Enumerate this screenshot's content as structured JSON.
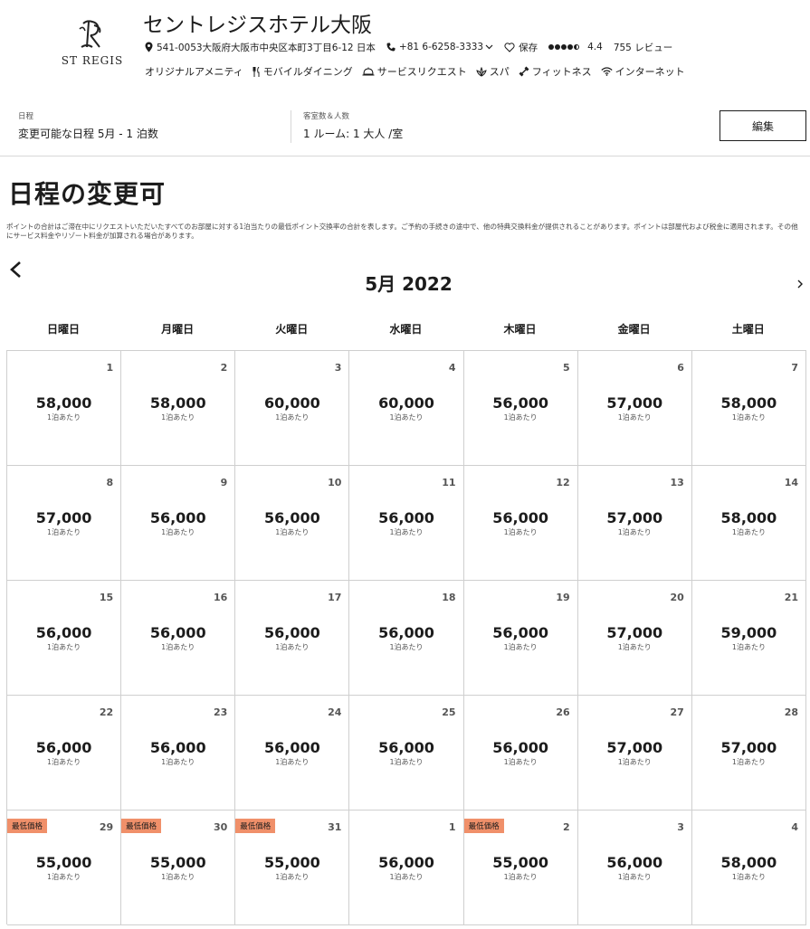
{
  "hotel": {
    "logo_text": "ST REGIS",
    "name": "セントレジスホテル大阪",
    "address": "541-0053大阪府大阪市中央区本町3丁目6-12 日本",
    "phone": "+81 6-6258-3333",
    "save_label": "保存",
    "rating_value": 4.5,
    "rating_text": "4.4",
    "reviews": "755 レビュー",
    "amenities": [
      {
        "label": "オリジナルアメニティ",
        "icon": "amenity-icon"
      },
      {
        "label": "モバイルダイニング",
        "icon": "dining-icon"
      },
      {
        "label": "サービスリクエスト",
        "icon": "service-bell-icon"
      },
      {
        "label": "スパ",
        "icon": "spa-icon"
      },
      {
        "label": "フィットネス",
        "icon": "fitness-icon"
      },
      {
        "label": "インターネット",
        "icon": "wifi-icon"
      }
    ]
  },
  "search": {
    "dates_label": "日程",
    "dates_value": "変更可能な日程 5月 - 1 泊数",
    "rooms_label": "客室数＆人数",
    "rooms_value": "1 ルーム: 1 大人 /室",
    "edit_label": "編集"
  },
  "page": {
    "title": "日程の変更可",
    "note": "ポイントの合計はご滞在中にリクエストいただいたすべてのお部屋に対する1泊当たりの最低ポイント交換率の合計を表します。ご予約の手続きの途中で、他の特典交換料金が提供されることがあります。ポイントは部屋代および税金に適用されます。その他にサービス料金やリゾート料金が加算される場合があります。"
  },
  "calendar": {
    "month_label": "5月 2022",
    "weekdays": [
      "日曜日",
      "月曜日",
      "火曜日",
      "水曜日",
      "木曜日",
      "金曜日",
      "土曜日"
    ],
    "per_night": "1泊あたり",
    "badge_label": "最低価格",
    "weeks": [
      [
        {
          "day": "1",
          "price": "58,000"
        },
        {
          "day": "2",
          "price": "58,000"
        },
        {
          "day": "3",
          "price": "60,000"
        },
        {
          "day": "4",
          "price": "60,000"
        },
        {
          "day": "5",
          "price": "56,000"
        },
        {
          "day": "6",
          "price": "57,000"
        },
        {
          "day": "7",
          "price": "58,000"
        }
      ],
      [
        {
          "day": "8",
          "price": "57,000"
        },
        {
          "day": "9",
          "price": "56,000"
        },
        {
          "day": "10",
          "price": "56,000"
        },
        {
          "day": "11",
          "price": "56,000"
        },
        {
          "day": "12",
          "price": "56,000"
        },
        {
          "day": "13",
          "price": "57,000"
        },
        {
          "day": "14",
          "price": "58,000"
        }
      ],
      [
        {
          "day": "15",
          "price": "56,000"
        },
        {
          "day": "16",
          "price": "56,000"
        },
        {
          "day": "17",
          "price": "56,000"
        },
        {
          "day": "18",
          "price": "56,000"
        },
        {
          "day": "19",
          "price": "56,000"
        },
        {
          "day": "20",
          "price": "57,000"
        },
        {
          "day": "21",
          "price": "59,000"
        }
      ],
      [
        {
          "day": "22",
          "price": "56,000"
        },
        {
          "day": "23",
          "price": "56,000"
        },
        {
          "day": "24",
          "price": "56,000"
        },
        {
          "day": "25",
          "price": "56,000"
        },
        {
          "day": "26",
          "price": "56,000"
        },
        {
          "day": "27",
          "price": "57,000"
        },
        {
          "day": "28",
          "price": "57,000"
        }
      ],
      [
        {
          "day": "29",
          "price": "55,000",
          "lowest": true
        },
        {
          "day": "30",
          "price": "55,000",
          "lowest": true
        },
        {
          "day": "31",
          "price": "55,000",
          "lowest": true
        },
        {
          "day": "1",
          "price": "56,000"
        },
        {
          "day": "2",
          "price": "55,000",
          "lowest": true
        },
        {
          "day": "3",
          "price": "56,000"
        },
        {
          "day": "4",
          "price": "58,000"
        }
      ]
    ]
  }
}
